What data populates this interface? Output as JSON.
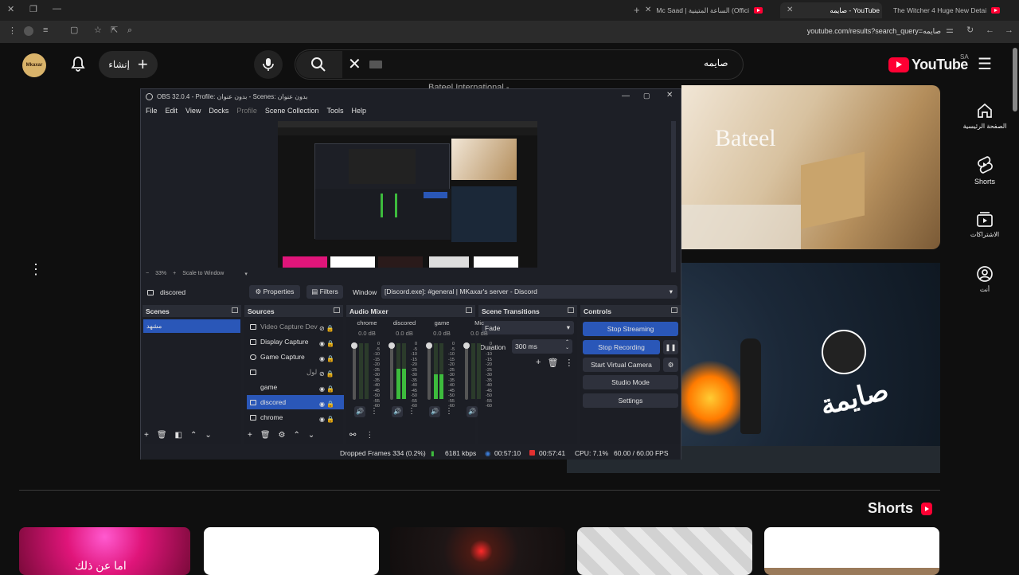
{
  "browser": {
    "tabs": [
      {
        "title": "The Witcher 4 Huge New Detai",
        "active": false
      },
      {
        "title": "صايمه - YouTube",
        "active": true
      },
      {
        "title": "Mc Saad | الساعة المتينية (Offici",
        "active": false
      }
    ],
    "url": "youtube.com/results?search_query=صايمه"
  },
  "youtube": {
    "logo": "YouTube",
    "region": "SA",
    "search_query": "صايمه",
    "create_label": "إنشاء",
    "avatar_text": "Mkaxar",
    "sidebar": [
      {
        "label": "الصفحة الرئيسية",
        "icon": "home-icon"
      },
      {
        "label": "Shorts",
        "icon": "shorts-icon"
      },
      {
        "label": "الاشتراكات",
        "icon": "subscriptions-icon"
      },
      {
        "label": "أنت",
        "icon": "you-icon"
      }
    ],
    "video1": {
      "title_partial": "Bateel International - ...",
      "thumb_text": "Bateel"
    },
    "video2": {
      "thumb_text": "صايمة"
    },
    "shorts_title": "Shorts",
    "shorts_text": "اما عن ذلك"
  },
  "obs": {
    "title": "OBS 32.0.4 - Profile: بدون عنوان - Scenes: بدون عنوان",
    "menu": [
      "File",
      "Edit",
      "View",
      "Docks",
      "Profile",
      "Scene Collection",
      "Tools",
      "Help"
    ],
    "zoom": "33%",
    "scale_mode": "Scale to Window",
    "selected_source": "discored",
    "properties_label": "Properties",
    "filters_label": "Filters",
    "window_label": "Window",
    "window_value": "[Discord.exe]: #general | MKaxar's server - Discord",
    "scenes_title": "Scenes",
    "scenes": [
      "مشهد"
    ],
    "sources_title": "Sources",
    "sources": [
      "Video Capture Dev",
      "Display Capture",
      "Game Capture",
      "لول",
      "game",
      "discored",
      "chrome"
    ],
    "mixer_title": "Audio Mixer",
    "mixer_channels": [
      {
        "name": "chrome",
        "db": "0.0 dB",
        "level": 0.0
      },
      {
        "name": "discored",
        "db": "0.0 dB",
        "level": 0.55
      },
      {
        "name": "game",
        "db": "0.0 dB",
        "level": 0.45
      },
      {
        "name": "Mic",
        "db": "0.0 dB",
        "level": 0.0
      }
    ],
    "scale_marks": [
      "0",
      "-5",
      "-10",
      "-15",
      "-20",
      "-25",
      "-30",
      "-35",
      "-40",
      "-45",
      "-50",
      "-55",
      "-60"
    ],
    "transitions_title": "Scene Transitions",
    "transition": "Fade",
    "duration_label": "Duration",
    "duration": "300 ms",
    "controls_title": "Controls",
    "controls": {
      "stop_streaming": "Stop Streaming",
      "stop_recording": "Stop Recording",
      "virtual_camera": "Start Virtual Camera",
      "studio_mode": "Studio Mode",
      "settings": "Settings"
    },
    "status": {
      "dropped": "Dropped Frames 334 (0.2%)",
      "kbps": "6181 kbps",
      "stream_time": "00:57:10",
      "rec_time": "00:57:41",
      "cpu": "CPU: 7.1%",
      "fps": "60.00 / 60.00 FPS"
    }
  },
  "colors": {
    "accent": "#2a57b8",
    "youtube_red": "#ff0033",
    "bg": "#0f0f0f"
  }
}
